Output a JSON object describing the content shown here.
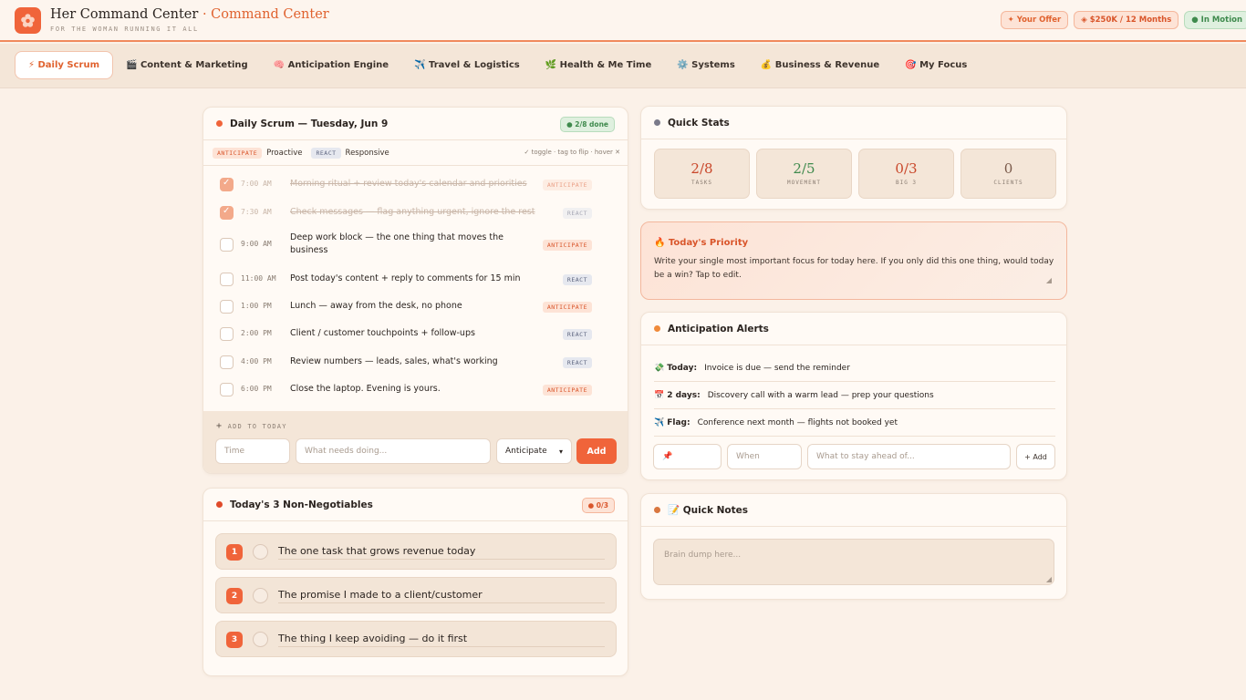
{
  "header": {
    "title": "Her Command Center",
    "title_accent": "· Command Center",
    "subtitle": "FOR THE WOMAN RUNNING IT ALL",
    "pills": {
      "offer": "✦ Your Offer",
      "money": "◈ $250K / 12 Months",
      "motion": "● In Motion"
    }
  },
  "nav": {
    "tabs": [
      {
        "label": "⚡ Daily Scrum"
      },
      {
        "label": "🎬 Content & Marketing"
      },
      {
        "label": "🧠 Anticipation Engine"
      },
      {
        "label": "✈️ Travel & Logistics"
      },
      {
        "label": "🌿 Health & Me Time"
      },
      {
        "label": "⚙️ Systems"
      },
      {
        "label": "💰 Business & Revenue"
      },
      {
        "label": "🎯 My Focus"
      }
    ]
  },
  "scrum": {
    "title": "Daily Scrum — Tuesday, Jun 9",
    "done_badge": "● 2/8 done",
    "legend": {
      "anticipate_tag": "ANTICIPATE",
      "anticipate_label": "Proactive",
      "react_tag": "REACT",
      "react_label": "Responsive",
      "hint": "✓ toggle · tag to flip · hover ✕"
    },
    "tasks": [
      {
        "time": "7:00 AM",
        "text": "Morning ritual + review today's calendar and priorities",
        "tag": "ANTICIPATE"
      },
      {
        "time": "7:30 AM",
        "text": "Check messages — flag anything urgent, ignore the rest",
        "tag": "REACT"
      },
      {
        "time": "9:00 AM",
        "text": "Deep work block — the one thing that moves the business",
        "tag": "ANTICIPATE"
      },
      {
        "time": "11:00 AM",
        "text": "Post today's content + reply to comments for 15 min",
        "tag": "REACT"
      },
      {
        "time": "1:00 PM",
        "text": "Lunch — away from the desk, no phone",
        "tag": "ANTICIPATE"
      },
      {
        "time": "2:00 PM",
        "text": "Client / customer touchpoints + follow-ups",
        "tag": "REACT"
      },
      {
        "time": "4:00 PM",
        "text": "Review numbers — leads, sales, what's working",
        "tag": "REACT"
      },
      {
        "time": "6:00 PM",
        "text": "Close the laptop. Evening is yours.",
        "tag": "ANTICIPATE"
      }
    ],
    "add": {
      "label": "ADD TO TODAY",
      "time_placeholder": "Time",
      "task_placeholder": "What needs doing...",
      "select_value": "Anticipate",
      "button": "Add"
    }
  },
  "nonneg": {
    "title": "Today's 3 Non-Negotiables",
    "badge": "● 0/3",
    "items": [
      {
        "num": "1",
        "text": "The one task that grows revenue today"
      },
      {
        "num": "2",
        "text": "The promise I made to a client/customer"
      },
      {
        "num": "3",
        "text": "The thing I keep avoiding — do it first"
      }
    ]
  },
  "stats": {
    "title": "Quick Stats",
    "items": [
      {
        "value": "2/8",
        "label": "TASKS"
      },
      {
        "value": "2/5",
        "label": "MOVEMENT"
      },
      {
        "value": "0/3",
        "label": "BIG 3"
      },
      {
        "value": "0",
        "label": "CLIENTS"
      }
    ]
  },
  "priority": {
    "title": "🔥 Today's Priority",
    "text": "Write your single most important focus for today here. If you only did this one thing, would today be a win? Tap to edit."
  },
  "alerts": {
    "title": "Anticipation Alerts",
    "items": [
      {
        "icon": "💸",
        "when": "Today:",
        "text": "Invoice is due — send the reminder"
      },
      {
        "icon": "📅",
        "when": "2 days:",
        "text": "Discovery call with a warm lead — prep your questions"
      },
      {
        "icon": "✈️",
        "when": "Flag:",
        "text": "Conference next month — flights not booked yet"
      }
    ],
    "add": {
      "icon_value": "📌",
      "when_placeholder": "When",
      "what_placeholder": "What to stay ahead of...",
      "button": "+ Add"
    }
  },
  "notes": {
    "title": "📝 Quick Notes",
    "placeholder": "Brain dump here..."
  },
  "colors": {
    "accent": "#f0643a",
    "anticipate": "#d9552a",
    "react": "#5f6680",
    "success": "#3f8a4d"
  }
}
